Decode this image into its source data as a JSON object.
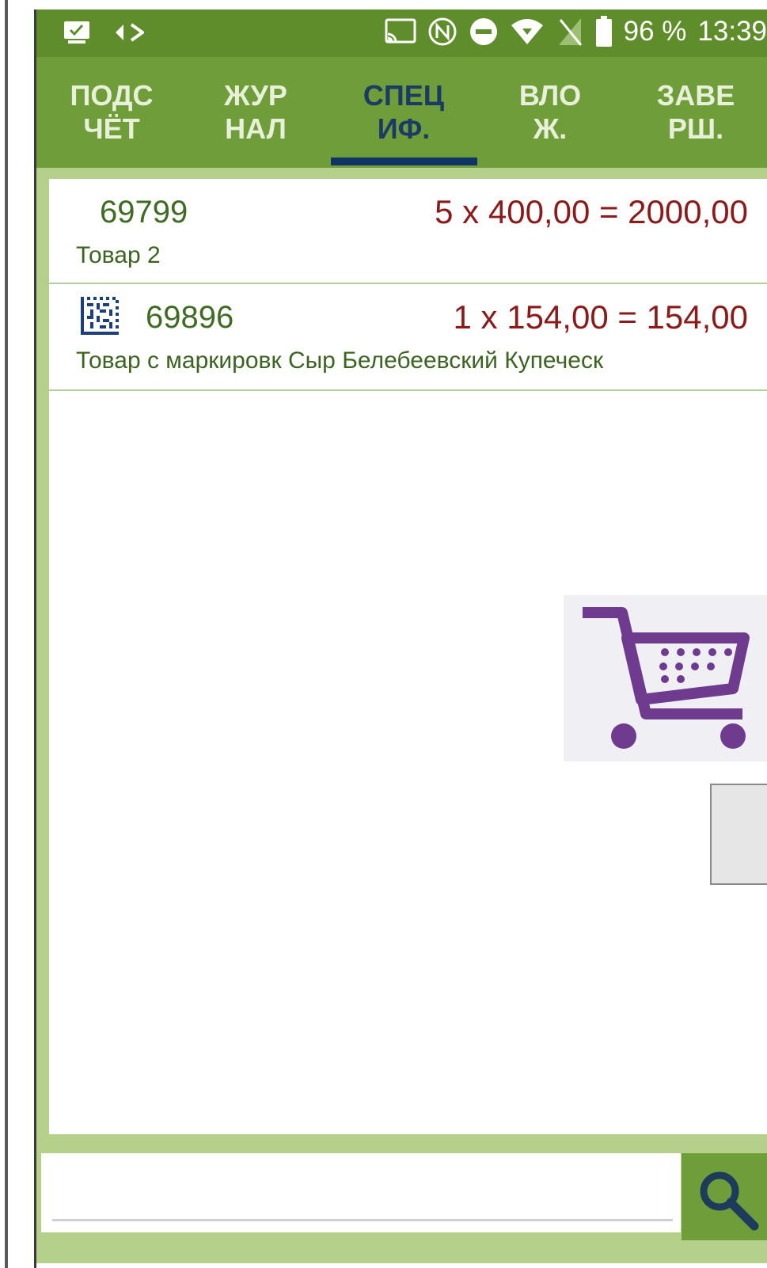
{
  "status_bar": {
    "battery_percent": "96 %",
    "time": "13:39",
    "icons": [
      "screenshot-icon",
      "data-sync-icon",
      "cast-icon",
      "nfc-icon",
      "do-not-disturb-icon",
      "wifi-icon",
      "no-sim-icon",
      "battery-icon"
    ]
  },
  "tabs": [
    {
      "line1": "ПОДС",
      "line2": "ЧЁТ",
      "active": false
    },
    {
      "line1": "ЖУР",
      "line2": "НАЛ",
      "active": false
    },
    {
      "line1": "СПЕЦ",
      "line2": "ИФ.",
      "active": true
    },
    {
      "line1": "ВЛО",
      "line2": "Ж.",
      "active": false
    },
    {
      "line1": "ЗАВЕ",
      "line2": "РШ.",
      "active": false
    }
  ],
  "items": [
    {
      "code": "69799",
      "calc": "5 x 400,00 = 2000,00",
      "name": "Товар 2",
      "marked": false
    },
    {
      "code": "69896",
      "calc": "1 x 154,00 = 154,00",
      "name": "Товар с маркировк Сыр Белебеевский Купеческ",
      "marked": true
    }
  ],
  "icons": {
    "cart": "shopping-cart-icon",
    "search": "search-icon",
    "datamatrix": "datamatrix-icon"
  },
  "colors": {
    "status_bar": "#5f8d2c",
    "tab_bar": "#6e9d39",
    "active_tab": "#1b3a66",
    "price": "#8b1a1a",
    "code": "#3f6b22",
    "cart": "#6e3b8f"
  },
  "search": {
    "value": "",
    "placeholder": ""
  }
}
